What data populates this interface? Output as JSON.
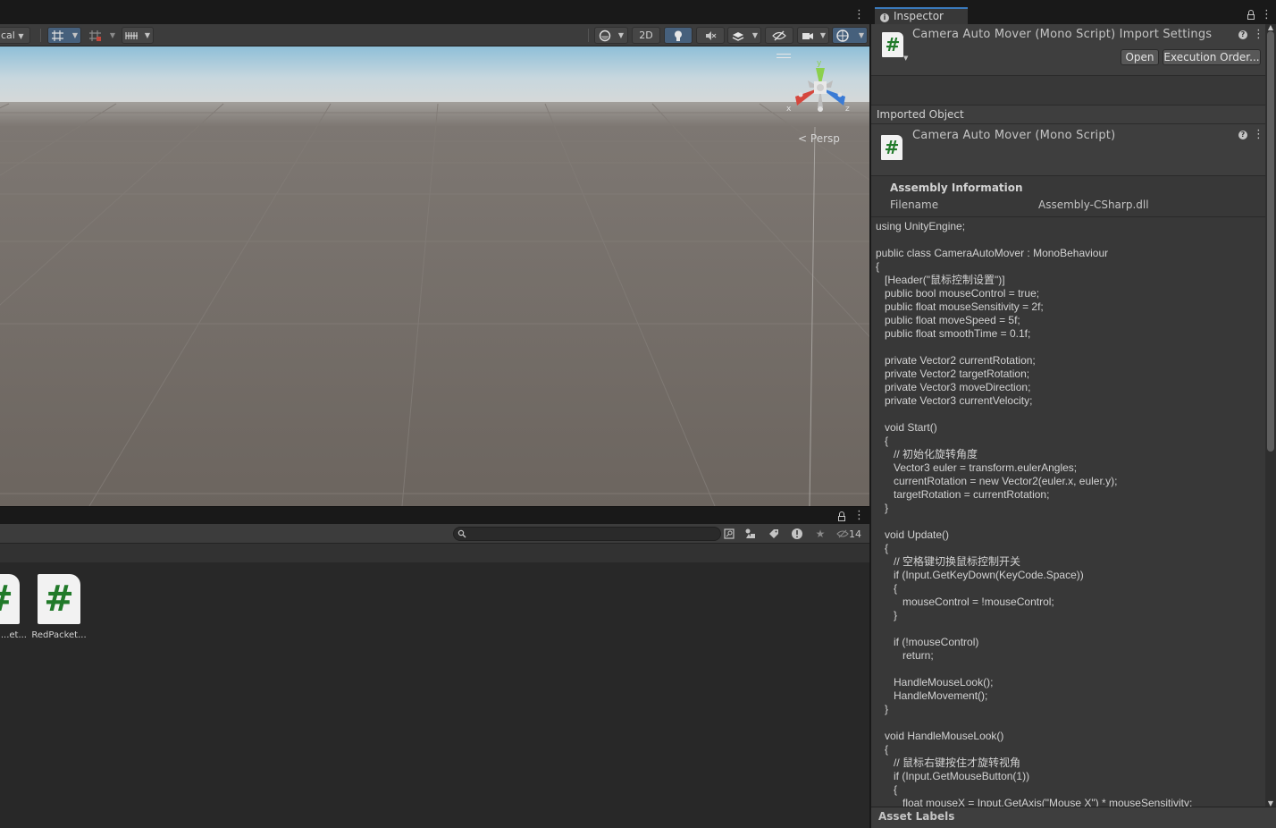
{
  "scene": {
    "pivot_dropdown": "cal",
    "buttons": {
      "twoD": "2D"
    },
    "persp_label": "Persp",
    "gizmo_axes": {
      "x": "x",
      "y": "y",
      "z": "z"
    }
  },
  "project": {
    "search_placeholder": "",
    "visible_count": "14",
    "assets": [
      {
        "name": "...et..."
      },
      {
        "name": "RedPacket..."
      }
    ]
  },
  "inspector": {
    "tab_label": "Inspector",
    "header_title": "Camera Auto Mover (Mono Script) Import Settings",
    "open_button": "Open",
    "execution_order_button": "Execution Order...",
    "imported_object_label": "Imported Object",
    "object_title": "Camera Auto Mover (Mono Script)",
    "assembly_header": "Assembly Information",
    "filename_key": "Filename",
    "filename_value": "Assembly-CSharp.dll",
    "code": "using UnityEngine;\n\npublic class CameraAutoMover : MonoBehaviour\n{\n   [Header(\"鼠标控制设置\")]\n   public bool mouseControl = true;\n   public float mouseSensitivity = 2f;\n   public float moveSpeed = 5f;\n   public float smoothTime = 0.1f;\n\n   private Vector2 currentRotation;\n   private Vector2 targetRotation;\n   private Vector3 moveDirection;\n   private Vector3 currentVelocity;\n\n   void Start()\n   {\n      // 初始化旋转角度\n      Vector3 euler = transform.eulerAngles;\n      currentRotation = new Vector2(euler.x, euler.y);\n      targetRotation = currentRotation;\n   }\n\n   void Update()\n   {\n      // 空格键切换鼠标控制开关\n      if (Input.GetKeyDown(KeyCode.Space))\n      {\n         mouseControl = !mouseControl;\n      }\n\n      if (!mouseControl)\n         return;\n\n      HandleMouseLook();\n      HandleMovement();\n   }\n\n   void HandleMouseLook()\n   {\n      // 鼠标右键按住才旋转视角\n      if (Input.GetMouseButton(1))\n      {\n         float mouseX = Input.GetAxis(\"Mouse X\") * mouseSensitivity;",
    "asset_labels": "Asset Labels"
  },
  "colors": {
    "accent_blue": "#3a79bb",
    "script_green": "#217a2a",
    "active_toggle": "#46607c"
  }
}
